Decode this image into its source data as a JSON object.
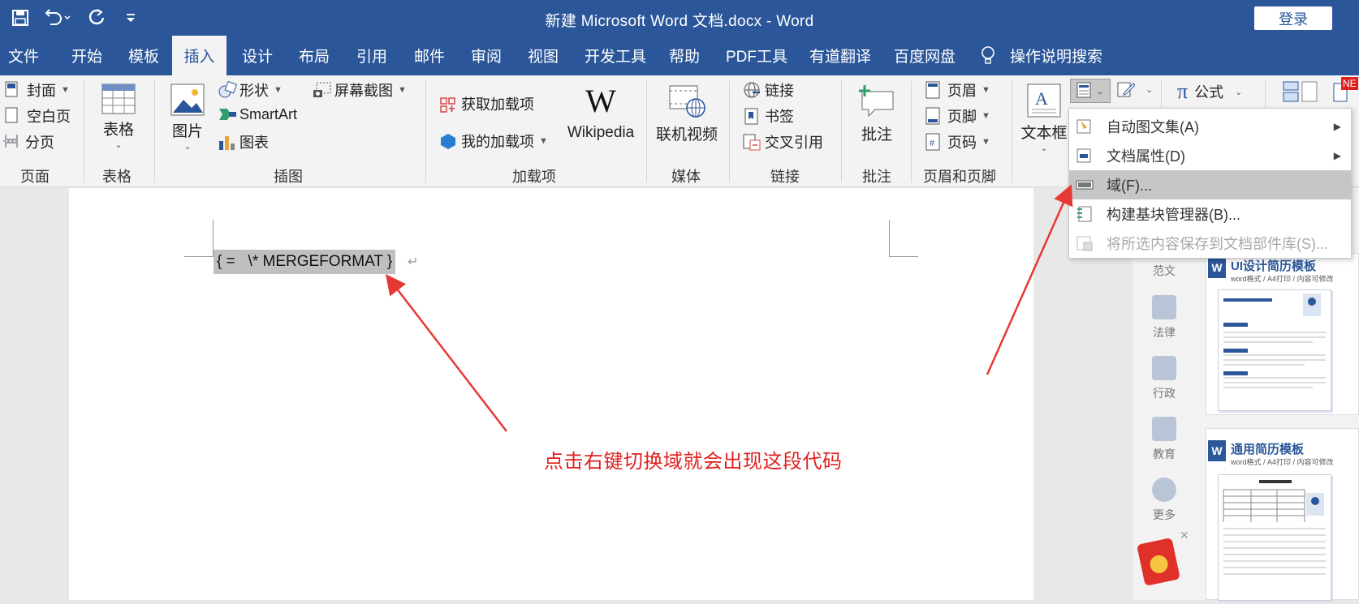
{
  "title_bar": {
    "doc_title": "新建 Microsoft Word 文档.docx  -  Word",
    "login": "登录"
  },
  "tabs": [
    "文件",
    "开始",
    "模板",
    "插入",
    "设计",
    "布局",
    "引用",
    "邮件",
    "审阅",
    "视图",
    "开发工具",
    "帮助",
    "PDF工具",
    "有道翻译",
    "百度网盘"
  ],
  "active_tab": "插入",
  "tell_me": "操作说明搜索",
  "ribbon": {
    "page": {
      "items": [
        "封面",
        "空白页",
        "分页"
      ],
      "group": "页面"
    },
    "table": {
      "label": "表格",
      "group": "表格"
    },
    "illus": {
      "picture": "图片",
      "shapes": "形状",
      "smartart": "SmartArt",
      "chart": "图表",
      "screenshot": "屏幕截图",
      "group": "插图"
    },
    "addins": {
      "get": "获取加载项",
      "mine": "我的加载项",
      "wiki_logo": "W",
      "wiki": "Wikipedia",
      "group": "加载项"
    },
    "media": {
      "video": "联机视频",
      "group": "媒体"
    },
    "links": {
      "link": "链接",
      "bookmark": "书签",
      "xref": "交叉引用",
      "group": "链接"
    },
    "comments": {
      "comment": "批注",
      "group": "批注"
    },
    "hf": {
      "header": "页眉",
      "footer": "页脚",
      "pagenum": "页码",
      "group": "页眉和页脚"
    },
    "text": {
      "textbox": "文本框"
    },
    "symbols": {
      "pi": "π",
      "equation": "公式"
    },
    "new_badge": "NE"
  },
  "document": {
    "field_code": "{ =   \\* MERGEFORMAT }",
    "para_mark": "↵",
    "annotation": "点击右键切换域就会出现这段代码"
  },
  "menu": [
    {
      "label": "自动图文集(A)",
      "submenu": true,
      "state": "normal"
    },
    {
      "label": "文档属性(D)",
      "submenu": true,
      "state": "normal"
    },
    {
      "label": "域(F)...",
      "submenu": false,
      "state": "highlighted"
    },
    {
      "label": "构建基块管理器(B)...",
      "submenu": false,
      "state": "normal"
    },
    {
      "label": "将所选内容保存到文档部件库(S)...",
      "submenu": false,
      "state": "disabled"
    }
  ],
  "side": {
    "categories": [
      "范文",
      "法律",
      "行政",
      "教育",
      "更多"
    ],
    "templates": [
      {
        "title": "UI设计简历模板",
        "sub": "word格式 / A4打印 / 内容可修改"
      },
      {
        "title": "通用简历模板",
        "sub": "word格式 / A4打印 / 内容可修改"
      }
    ],
    "close": "✕"
  },
  "colors": {
    "brand": "#2b579a",
    "annotation": "#e02020",
    "menu_highlight": "#c6c6c6"
  }
}
